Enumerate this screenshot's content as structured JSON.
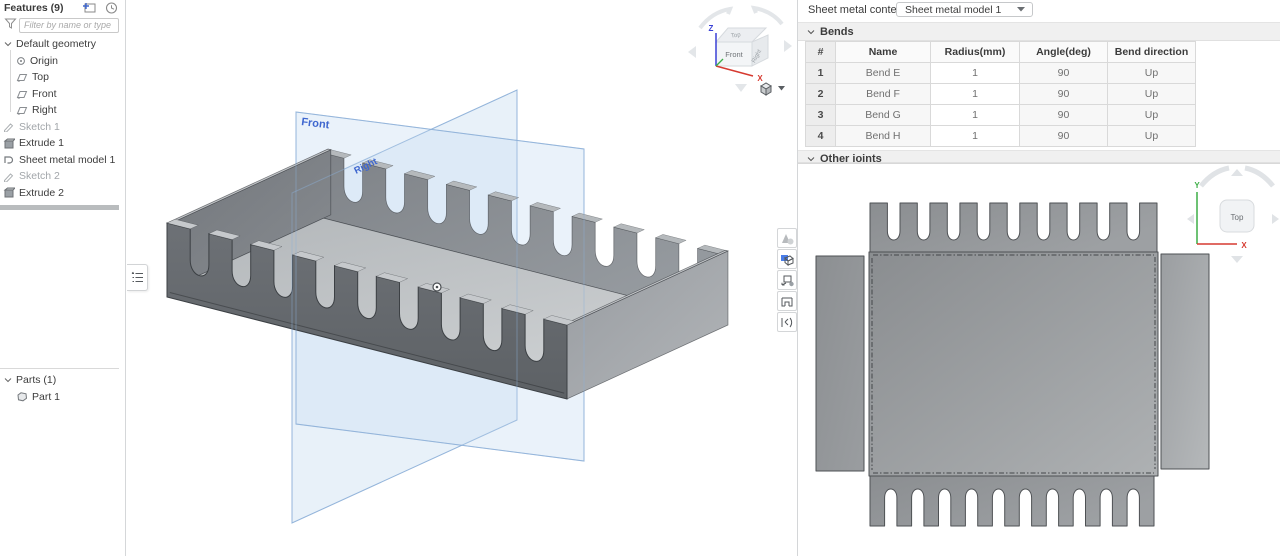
{
  "sidebar": {
    "title": "Features (9)",
    "filter_placeholder": "Filter by name or type",
    "default_geometry_label": "Default geometry",
    "tree_items": [
      "Origin",
      "Top",
      "Front",
      "Right"
    ],
    "feature_items": [
      {
        "label": "Sketch 1"
      },
      {
        "label": "Extrude 1"
      },
      {
        "label": "Sheet metal model 1"
      },
      {
        "label": "Sketch 2"
      },
      {
        "label": "Extrude 2"
      }
    ],
    "parts_header": "Parts (1)",
    "part_items": [
      "Part 1"
    ]
  },
  "viewport": {
    "front_plane_label": "Front",
    "right_plane_label": "Right",
    "view_cube": {
      "front": "Front",
      "top": "Top",
      "right": "Right",
      "axis_x": "X",
      "axis_z": "Z"
    }
  },
  "sheet_metal_panel": {
    "context_label": "Sheet metal context:",
    "context_value": "Sheet metal model 1",
    "bends_section_label": "Bends",
    "other_section_label": "Other joints",
    "table": {
      "headers": [
        "#",
        "Name",
        "Radius(mm)",
        "Angle(deg)",
        "Bend direction"
      ],
      "rows": [
        [
          "1",
          "Bend E",
          "1",
          "90",
          "Up"
        ],
        [
          "2",
          "Bend F",
          "1",
          "90",
          "Up"
        ],
        [
          "3",
          "Bend G",
          "1",
          "90",
          "Up"
        ],
        [
          "4",
          "Bend H",
          "1",
          "90",
          "Up"
        ]
      ]
    }
  },
  "flat_view": {
    "view_cube_top": "Top",
    "axis_x": "X",
    "axis_y": "Y"
  },
  "colors": {
    "accent_blue": "#3f67cf",
    "axis_x_red": "#d63a30",
    "axis_y_green": "#3cae46",
    "axis_z_blue": "#3a41d6",
    "plane_stroke": "#8cafd8"
  }
}
